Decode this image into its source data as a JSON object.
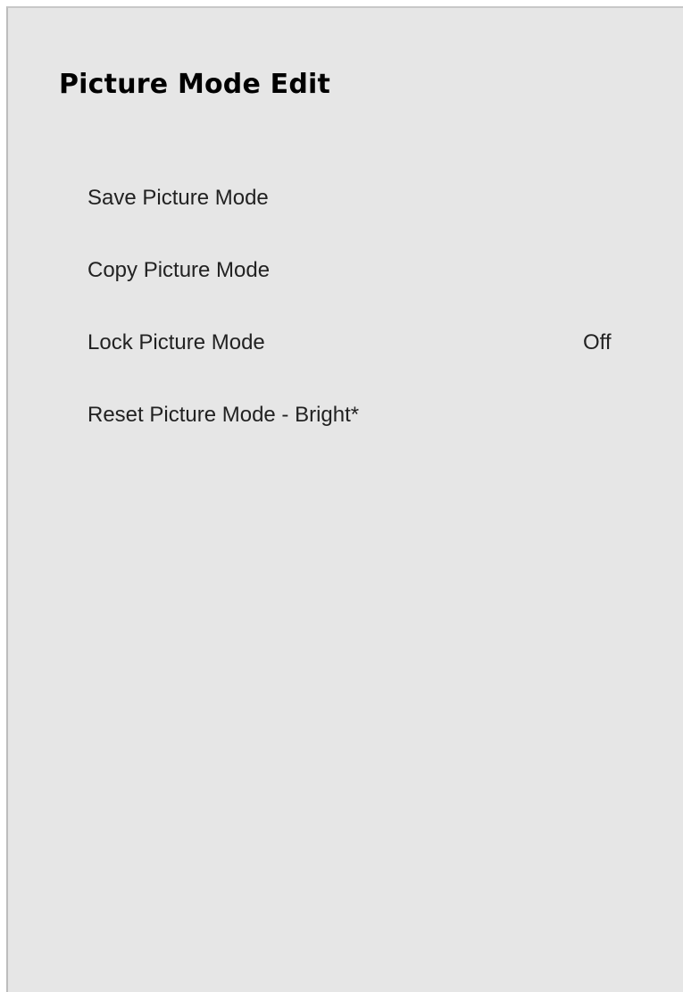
{
  "menu": {
    "title": "Picture Mode Edit",
    "items": [
      {
        "label": "Save Picture Mode",
        "value": ""
      },
      {
        "label": "Copy Picture Mode",
        "value": ""
      },
      {
        "label": "Lock Picture Mode",
        "value": "Off"
      },
      {
        "label": "Reset Picture Mode - Bright*",
        "value": ""
      }
    ]
  },
  "colors": {
    "panel_background": "#e6e6e6",
    "title_text": "#000000",
    "item_text": "#222222"
  }
}
